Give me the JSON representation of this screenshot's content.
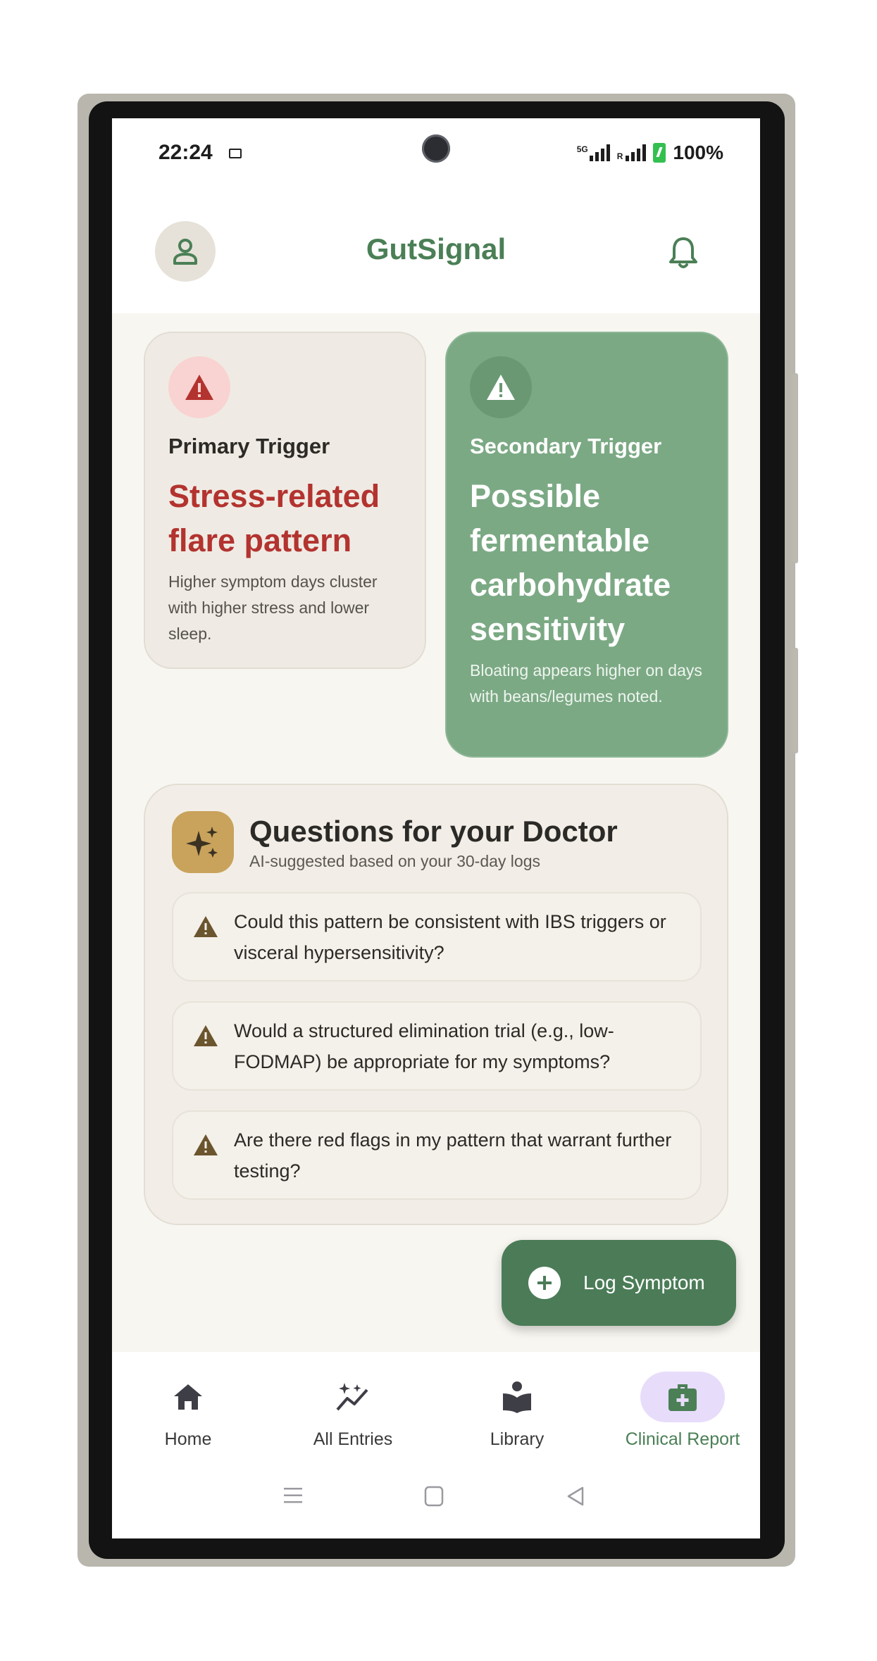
{
  "status_bar": {
    "time": "22:24",
    "network": "5G",
    "roaming": "R",
    "battery": "100%"
  },
  "app": {
    "title": "GutSignal"
  },
  "triggers": {
    "primary": {
      "label": "Primary Trigger",
      "headline": "Stress-related flare pattern",
      "description": "Higher symptom days cluster with higher stress and lower sleep."
    },
    "secondary": {
      "label": "Secondary Trigger",
      "headline": "Possible fermentable carbohydrate sensitivity",
      "description": "Bloating appears higher on days with beans/legumes noted."
    }
  },
  "questions": {
    "title": "Questions for your Doctor",
    "subtitle": "AI-suggested based on your 30-day logs",
    "items": [
      "Could this pattern be consistent with IBS triggers or visceral hypersensitivity?",
      "Would a structured elimination trial (e.g., low-FODMAP) be appropriate for my symptoms?",
      "Are there red flags in my pattern that warrant further testing?"
    ]
  },
  "fab": {
    "label": "Log Symptom"
  },
  "nav": {
    "items": [
      {
        "label": "Home",
        "icon": "home-icon"
      },
      {
        "label": "All Entries",
        "icon": "sparkle-chart-icon"
      },
      {
        "label": "Library",
        "icon": "reading-icon"
      },
      {
        "label": "Clinical Report",
        "icon": "medical-kit-icon",
        "active": true
      }
    ]
  },
  "colors": {
    "brand_green": "#4b7f56",
    "alert_red": "#b3332f",
    "secondary_card": "#7ba984",
    "ai_tile": "#c9a35c",
    "active_nav_pill": "#e8dcfb"
  }
}
